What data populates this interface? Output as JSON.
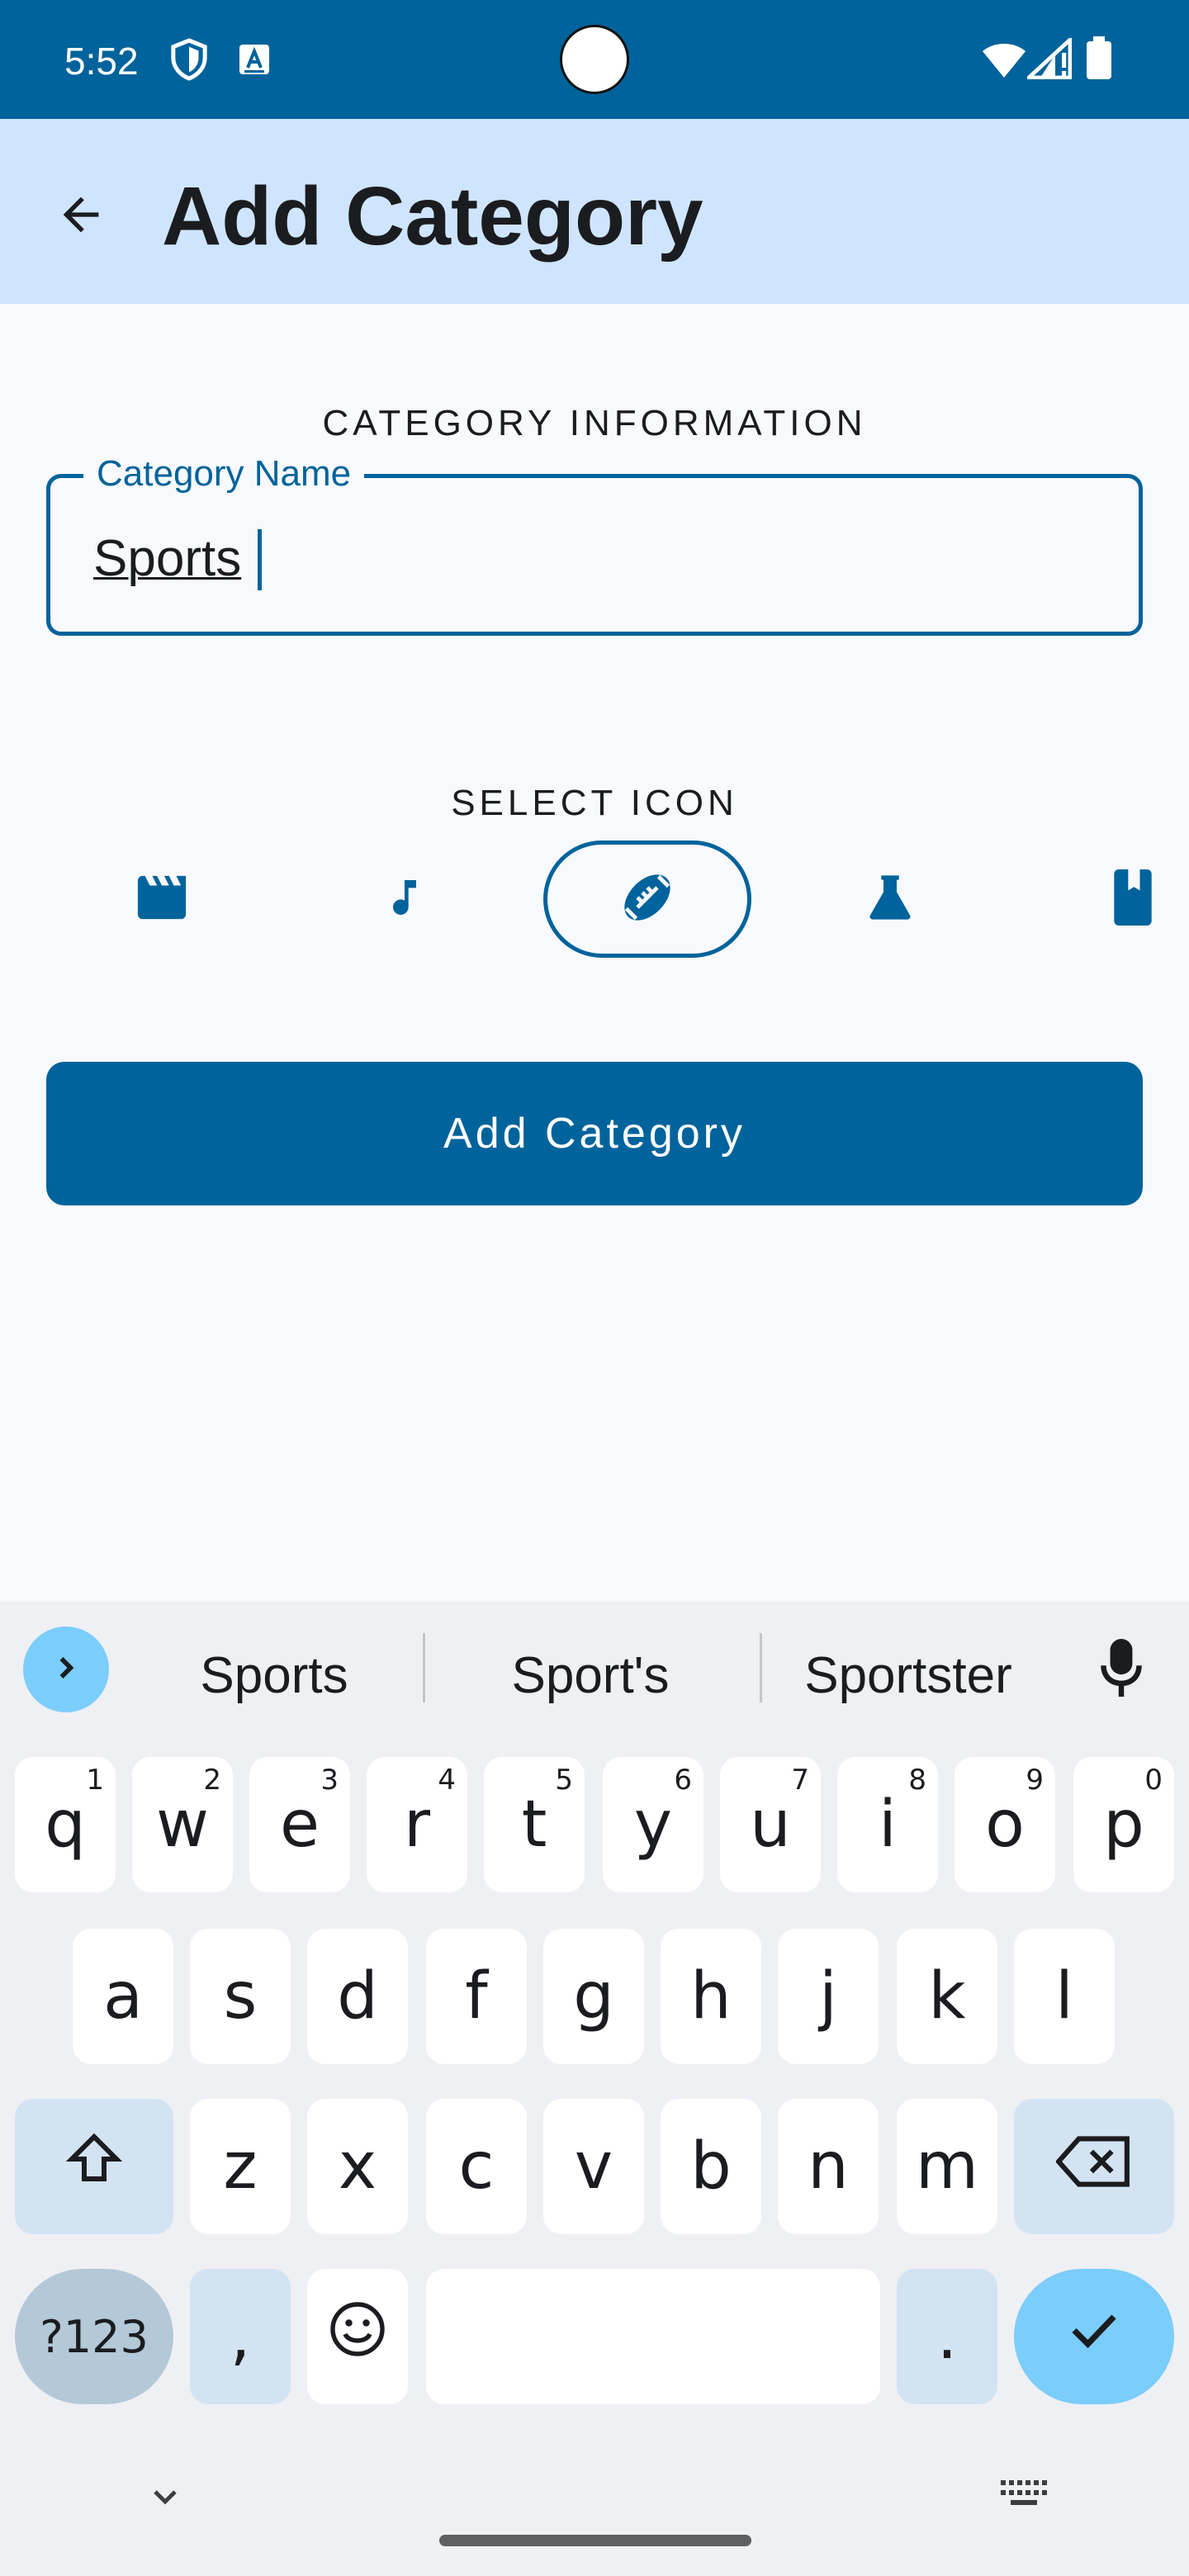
{
  "status_bar": {
    "time": "5:52",
    "icons": [
      "vpn-shield-icon",
      "accessibility-a-icon",
      "wifi-icon",
      "signal-icon",
      "battery-icon"
    ]
  },
  "app_bar": {
    "back_icon": "arrow-back-icon",
    "title": "Add Category"
  },
  "form": {
    "section_title": "CATEGORY INFORMATION",
    "name_label": "Category Name",
    "name_value": "Sports"
  },
  "icon_picker": {
    "section_title": "SELECT ICON",
    "icons": [
      "movie-clapper-icon",
      "music-note-icon",
      "football-icon",
      "science-flask-icon",
      "book-icon"
    ],
    "selected": "football-icon"
  },
  "submit_button": {
    "label": "Add Category"
  },
  "keyboard": {
    "suggestions": [
      "Sports",
      "Sport's",
      "Sportster"
    ],
    "row1": [
      {
        "k": "q",
        "h": "1"
      },
      {
        "k": "w",
        "h": "2"
      },
      {
        "k": "e",
        "h": "3"
      },
      {
        "k": "r",
        "h": "4"
      },
      {
        "k": "t",
        "h": "5"
      },
      {
        "k": "y",
        "h": "6"
      },
      {
        "k": "u",
        "h": "7"
      },
      {
        "k": "i",
        "h": "8"
      },
      {
        "k": "o",
        "h": "9"
      },
      {
        "k": "p",
        "h": "0"
      }
    ],
    "row2": [
      "a",
      "s",
      "d",
      "f",
      "g",
      "h",
      "j",
      "k",
      "l"
    ],
    "row3": [
      "z",
      "x",
      "c",
      "v",
      "b",
      "n",
      "m"
    ],
    "symbols_label": "?123",
    "comma": ",",
    "period": "."
  },
  "colors": {
    "primary": "#00639b",
    "app_bar": "#cfe5ff",
    "background": "#f8f9fd",
    "keyboard": "#eff0f4",
    "accent_key": "#7bcdfb"
  }
}
